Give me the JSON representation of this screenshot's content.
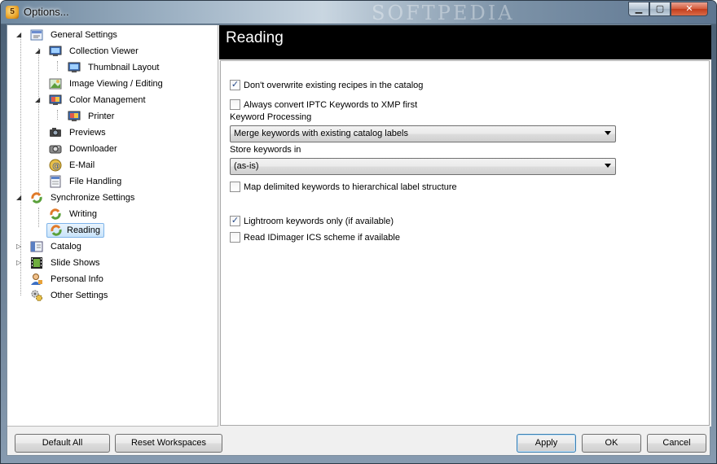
{
  "window": {
    "title": "Options...",
    "watermark": "SOFTPEDIA",
    "buttons": {
      "minimize": "▁",
      "maximize": "▢",
      "close": "✕"
    }
  },
  "tree": {
    "items": [
      {
        "label": "General Settings",
        "icon": "settings-icon",
        "expanded": true
      },
      {
        "label": "Collection Viewer",
        "icon": "monitor-icon",
        "expanded": true
      },
      {
        "label": "Thumbnail Layout",
        "icon": "monitor-icon"
      },
      {
        "label": "Image Viewing / Editing",
        "icon": "image-icon"
      },
      {
        "label": "Color Management",
        "icon": "monitor-icon",
        "expanded": true
      },
      {
        "label": "Printer",
        "icon": "monitor-icon"
      },
      {
        "label": "Previews",
        "icon": "camera-icon"
      },
      {
        "label": "Downloader",
        "icon": "camera-icon"
      },
      {
        "label": "E-Mail",
        "icon": "email-icon"
      },
      {
        "label": "File Handling",
        "icon": "file-icon"
      },
      {
        "label": "Synchronize Settings",
        "icon": "sync-icon",
        "expanded": true
      },
      {
        "label": "Writing",
        "icon": "sync-icon"
      },
      {
        "label": "Reading",
        "icon": "sync-icon",
        "selected": true
      },
      {
        "label": "Catalog",
        "icon": "catalog-icon",
        "expanded": false
      },
      {
        "label": "Slide Shows",
        "icon": "film-icon",
        "expanded": false
      },
      {
        "label": "Personal Info",
        "icon": "person-icon"
      },
      {
        "label": "Other Settings",
        "icon": "gears-icon"
      }
    ]
  },
  "panel": {
    "title": "Reading",
    "options": {
      "dont_overwrite": {
        "label": "Don't overwrite existing recipes in the catalog",
        "checked": true
      },
      "always_convert": {
        "label": "Always convert IPTC Keywords to XMP first",
        "checked": false
      },
      "keyword_processing_label": "Keyword Processing",
      "keyword_processing_value": "Merge keywords with existing catalog labels",
      "store_keywords_label": "Store keywords in",
      "store_keywords_value": "(as-is)",
      "map_delimited": {
        "label": "Map delimited keywords to hierarchical label structure",
        "checked": false
      },
      "lightroom_only": {
        "label": "Lightroom keywords only (if available)",
        "checked": true
      },
      "read_idimager": {
        "label": "Read IDimager ICS scheme if available",
        "checked": false
      }
    }
  },
  "footer": {
    "default_all": "Default All",
    "reset_workspaces": "Reset Workspaces",
    "apply": "Apply",
    "ok": "OK",
    "cancel": "Cancel"
  },
  "colors": {
    "selection": "#c9e4fa",
    "header_bg": "#000000",
    "accent": "#3c7fb1"
  }
}
